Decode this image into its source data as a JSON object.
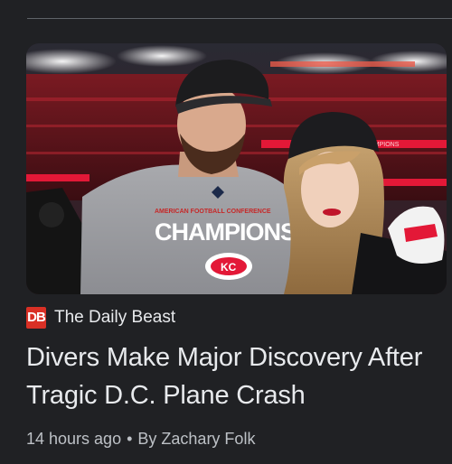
{
  "source": {
    "logo_text": "DB",
    "logo_color": "#d93025",
    "name": "The Daily Beast"
  },
  "article": {
    "headline": "Divers Make Major Discovery After Tragic D.C. Plane Crash",
    "time_ago": "14 hours ago",
    "separator": "•",
    "byline": "By Zachary Folk"
  },
  "image": {
    "shirt_text_top": "AMERICAN FOOTBALL CONFERENCE",
    "shirt_text_main": "CHAMPIONS",
    "stadium_banner": "CHAMPIONS"
  },
  "colors": {
    "background": "#202124",
    "text_primary": "#e8eaed",
    "text_secondary": "#bdc1c6",
    "chiefs_red": "#e31837"
  }
}
